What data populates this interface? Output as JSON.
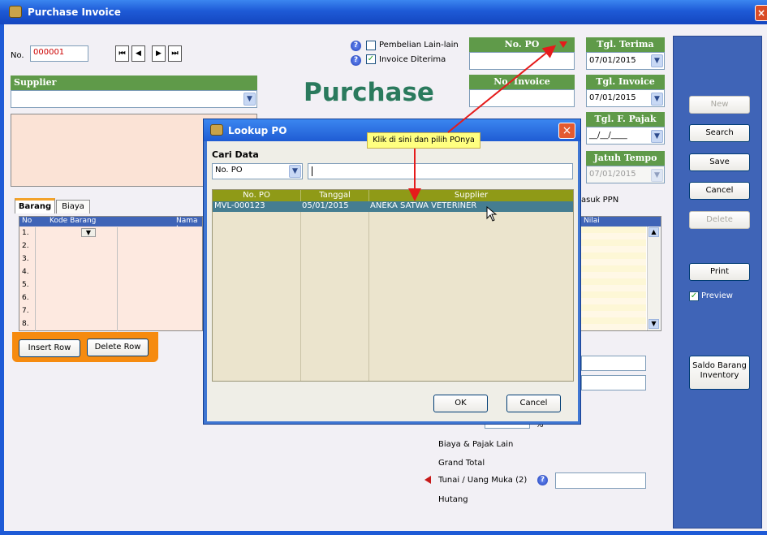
{
  "window": {
    "title": "Purchase Invoice",
    "close": "×"
  },
  "header": {
    "no_label": "No.",
    "no_value": "000001",
    "nav": [
      "⏮",
      "◀",
      "▶",
      "⏭"
    ],
    "pembelian_lain": "Pembelian Lain-lain",
    "invoice_diterima": "Invoice Diterima",
    "no_po_label": "No. PO",
    "tgl_terima_label": "Tgl. Terima",
    "tgl_terima_value": "07/01/2015",
    "no_invoice_label": "No. Invoice",
    "tgl_invoice_label": "Tgl. Invoice",
    "tgl_invoice_value": "07/01/2015",
    "tgl_fpajak_label": "Tgl. F. Pajak",
    "tgl_fpajak_value": "__/__/____",
    "jatuh_tempo_label": "Jatuh Tempo",
    "jatuh_tempo_value": "07/01/2015",
    "big_title": "Purchase",
    "supplier_label": "Supplier",
    "termasuk_ppn": "asuk PPN"
  },
  "tabs": [
    "Barang",
    "Biaya"
  ],
  "grid": {
    "headers": [
      "No",
      "Kode Barang",
      "Nama I"
    ],
    "rows": [
      "1.",
      "2.",
      "3.",
      "4.",
      "5.",
      "6.",
      "7.",
      "8."
    ],
    "nilai_header": "Nilai"
  },
  "row_buttons": {
    "insert": "Insert Row",
    "delete": "Delete Row"
  },
  "right_panel": {
    "new": "New",
    "search": "Search",
    "save": "Save",
    "cancel": "Cancel",
    "delete": "Delete",
    "print": "Print",
    "preview": "Preview",
    "saldo_line1": "Saldo Barang",
    "saldo_line2": "Inventory"
  },
  "totals": {
    "percent": "%",
    "biaya_pajak": "Biaya & Pajak Lain",
    "grand_total": "Grand Total",
    "tunai": "Tunai / Uang Muka (2)",
    "hutang": "Hutang"
  },
  "lookup": {
    "title": "Lookup PO",
    "cari_data_label": "Cari Data",
    "field_select": "No. PO",
    "search_value": "",
    "columns": [
      "No. PO",
      "Tanggal",
      "Supplier"
    ],
    "rows": [
      {
        "no_po": "MVL-000123",
        "tanggal": "05/01/2015",
        "supplier": "ANEKA SATWA VETERINER"
      }
    ],
    "ok": "OK",
    "cancel": "Cancel"
  },
  "tooltip": "Klik di sini dan pilih POnya",
  "colors": {
    "title_blue": "#1e5ad6",
    "header_green": "#5f9a49",
    "panel_blue": "#3f64b7",
    "grid_olive": "#8f9a17",
    "selected_row": "#457d91",
    "tooltip_yellow": "#ffff80",
    "arrow_red": "#e51b1b"
  }
}
